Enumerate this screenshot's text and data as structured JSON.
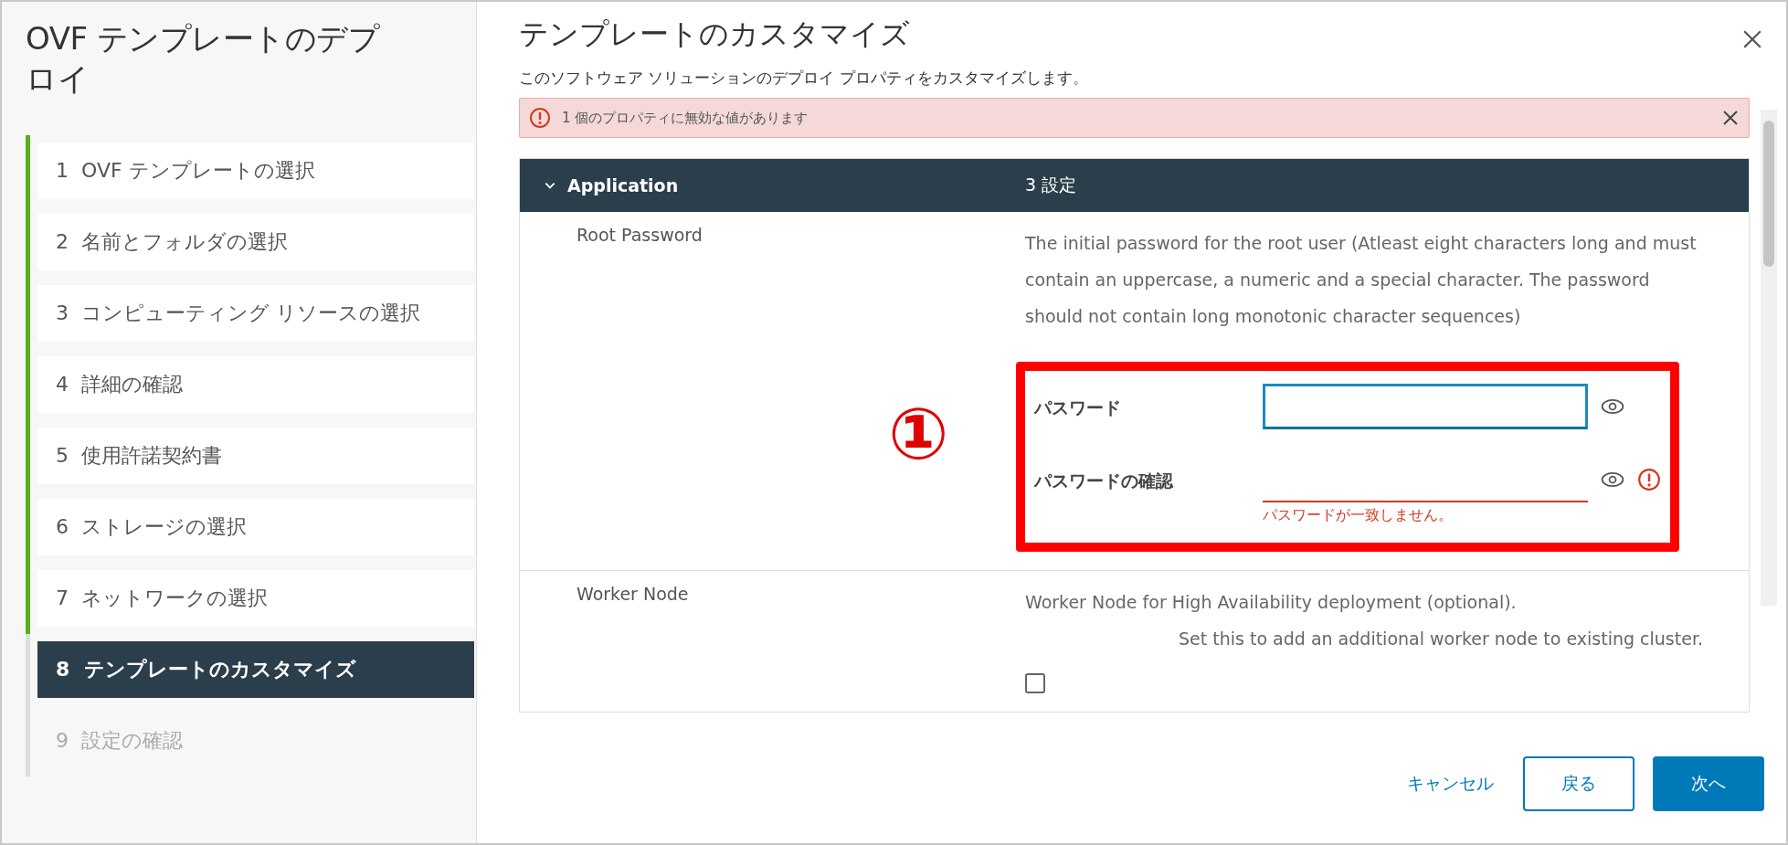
{
  "sidebar": {
    "title": "OVF テンプレートのデプロイ",
    "steps": [
      {
        "number": "1",
        "label": "OVF テンプレートの選択",
        "completed": true,
        "selected": false,
        "disabled": false
      },
      {
        "number": "2",
        "label": "名前とフォルダの選択",
        "completed": true,
        "selected": false,
        "disabled": false
      },
      {
        "number": "3",
        "label": "コンピューティング リソースの選択",
        "completed": true,
        "selected": false,
        "disabled": false
      },
      {
        "number": "4",
        "label": "詳細の確認",
        "completed": true,
        "selected": false,
        "disabled": false
      },
      {
        "number": "5",
        "label": "使用許諾契約書",
        "completed": true,
        "selected": false,
        "disabled": false
      },
      {
        "number": "6",
        "label": "ストレージの選択",
        "completed": true,
        "selected": false,
        "disabled": false
      },
      {
        "number": "7",
        "label": "ネットワークの選択",
        "completed": true,
        "selected": false,
        "disabled": false
      },
      {
        "number": "8",
        "label": "テンプレートのカスタマイズ",
        "completed": false,
        "selected": true,
        "disabled": false
      },
      {
        "number": "9",
        "label": "設定の確認",
        "completed": false,
        "selected": false,
        "disabled": true
      }
    ]
  },
  "main": {
    "title": "テンプレートのカスタマイズ",
    "subtitle": "このソフトウェア ソリューションのデプロイ プロパティをカスタマイズします。",
    "alert": {
      "message": "1 個のプロパティに無効な値があります"
    },
    "group": {
      "name": "Application",
      "expanded": true,
      "count": "3 設定"
    },
    "properties": [
      {
        "kind": "password",
        "label": "Root Password",
        "description": "The initial password for the root user (Atleast eight characters long and must contain an uppercase, a numeric and a special character. The password should not contain long monotonic character sequences)",
        "annotation": "①",
        "fields": [
          {
            "label": "パスワード",
            "focused": true,
            "invalid": false
          },
          {
            "label": "パスワードの確認",
            "focused": false,
            "invalid": true,
            "error": "パスワードが一致しません。"
          }
        ]
      },
      {
        "kind": "checkbox",
        "label": "Worker Node",
        "description": "Worker Node for High Availability deployment (optional).",
        "description_2": "Set this to add an additional worker node to existing cluster.",
        "checked": false
      }
    ]
  },
  "footer": {
    "buttons": [
      {
        "kind": "link",
        "label": "キャンセル"
      },
      {
        "kind": "outline",
        "label": "戻る"
      },
      {
        "kind": "primary",
        "label": "次へ"
      }
    ]
  }
}
